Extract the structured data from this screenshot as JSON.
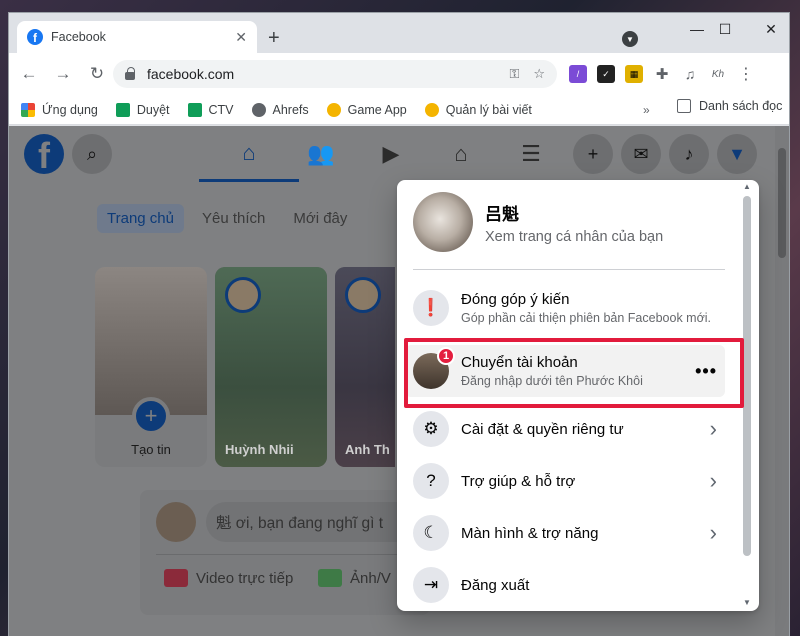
{
  "colors": {
    "accent": "#1877f2",
    "highlight_box": "#e21b3c",
    "badge": "#e41e3f"
  },
  "browser": {
    "tab_title": "Facebook",
    "url": "facebook.com",
    "bookmarks": [
      "Ứng dụng",
      "Duyệt",
      "CTV",
      "Ahrefs",
      "Game App",
      "Quản lý bài viết"
    ],
    "reading_list": "Danh sách đọc",
    "bookmarks_more": "»"
  },
  "facebook": {
    "feed_tabs": [
      "Trang chủ",
      "Yêu thích",
      "Mới đây"
    ],
    "stories": {
      "create_label": "Tạo tin",
      "story1_name": "Huỳnh Nhii",
      "story2_name": "Anh Th"
    },
    "composer": {
      "placeholder": "魁 ơi, bạn đang nghĩ gì t",
      "live_video": "Video trực tiếp",
      "photo": "Ảnh/V"
    }
  },
  "menu": {
    "profile_name": "吕魁",
    "profile_sub": "Xem trang cá nhân của bạn",
    "items": [
      {
        "title": "Đóng góp ý kiến",
        "subtitle": "Góp phần cải thiện phiên bản Facebook mới."
      },
      {
        "title": "Chuyển tài khoản",
        "subtitle": "Đăng nhập dưới tên Phước Khôi",
        "badge": "1",
        "more": "•••"
      },
      {
        "title": "Cài đặt & quyền riêng tư"
      },
      {
        "title": "Trợ giúp & hỗ trợ"
      },
      {
        "title": "Màn hình & trợ năng"
      },
      {
        "title": "Đăng xuất"
      }
    ]
  }
}
